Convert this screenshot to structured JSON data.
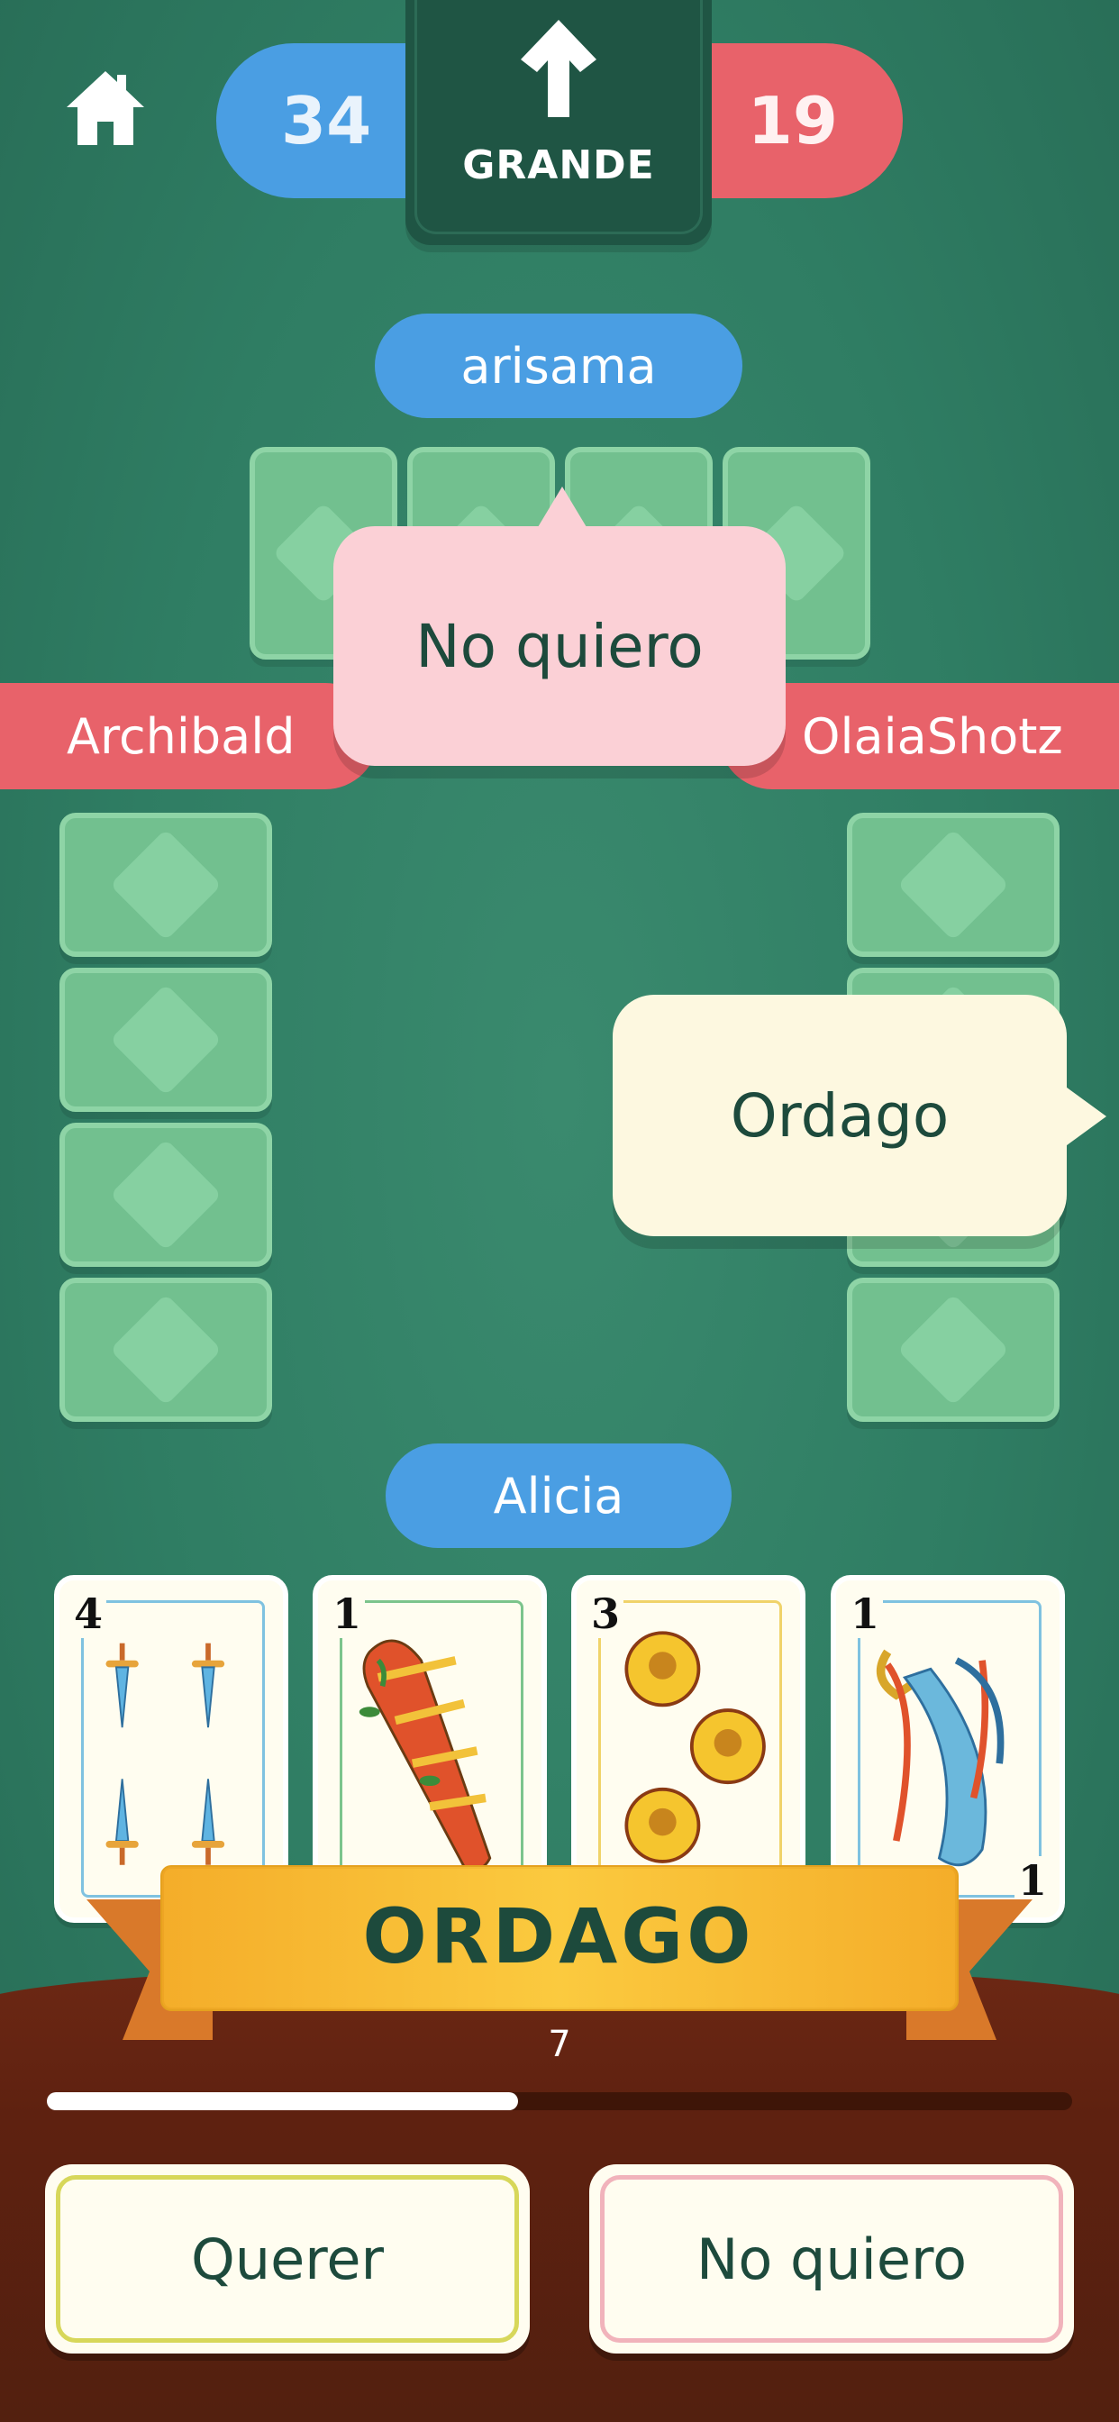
{
  "scores": {
    "team_blue": "34",
    "team_red": "19"
  },
  "phase": {
    "label": "GRANDE",
    "icon": "arrow-up-icon"
  },
  "players": {
    "top": "arisama",
    "left": "Archibald",
    "right": "OlaiaShotz",
    "bottom": "Alicia"
  },
  "bubbles": {
    "top": "No quiero",
    "right": "Ordago"
  },
  "hand": [
    {
      "rank": "4",
      "suit": "espadas"
    },
    {
      "rank": "1",
      "suit": "bastos"
    },
    {
      "rank": "3",
      "suit": "oros"
    },
    {
      "rank": "1",
      "suit": "espadas",
      "corner_rank": "1"
    }
  ],
  "banner": {
    "text": "ORDAGO"
  },
  "timer": {
    "seconds": "7",
    "progress": 0.46
  },
  "actions": {
    "accept": "Querer",
    "decline": "No quiero"
  },
  "colors": {
    "team_blue": "#4a9ee3",
    "team_red": "#e8626a",
    "felt": "#2f7d63",
    "banner": "#f5b52e"
  }
}
